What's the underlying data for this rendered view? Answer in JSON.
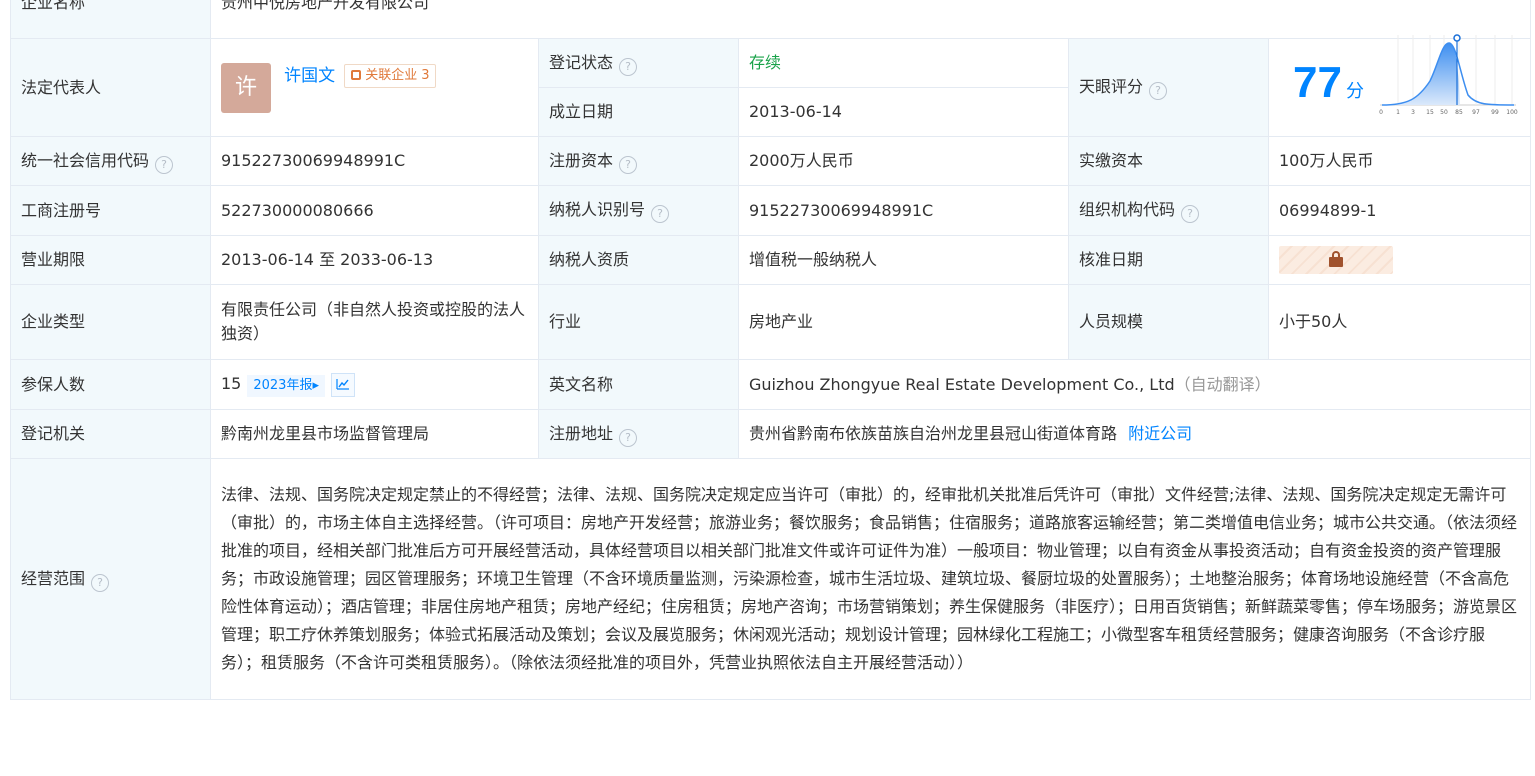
{
  "prev_row": {
    "label": "企业名称",
    "value": "贵州中悦房地产开发有限公司"
  },
  "legal_rep": {
    "label": "法定代表人",
    "avatar_char": "许",
    "name": "许国文",
    "related_label": "关联企业",
    "related_count": "3"
  },
  "reg_status": {
    "label": "登记状态",
    "value": "存续"
  },
  "est_date": {
    "label": "成立日期",
    "value": "2013-06-14"
  },
  "tianyan_score": {
    "label": "天眼评分",
    "score": "77",
    "unit": "分",
    "curve_ticks": [
      "0",
      "1",
      "3",
      "15",
      "50",
      "85",
      "97",
      "99",
      "100"
    ]
  },
  "credit_code": {
    "label": "统一社会信用代码",
    "value": "91522730069948991C"
  },
  "reg_capital": {
    "label": "注册资本",
    "value": "2000万人民币"
  },
  "paid_capital": {
    "label": "实缴资本",
    "value": "100万人民币"
  },
  "biz_reg_no": {
    "label": "工商注册号",
    "value": "522730000080666"
  },
  "taxpayer_id": {
    "label": "纳税人识别号",
    "value": "91522730069948991C"
  },
  "org_code": {
    "label": "组织机构代码",
    "value": "06994899-1"
  },
  "biz_term": {
    "label": "营业期限",
    "value": "2013-06-14 至 2033-06-13"
  },
  "taxpayer_qual": {
    "label": "纳税人资质",
    "value": "增值税一般纳税人"
  },
  "approval_date": {
    "label": "核准日期"
  },
  "company_type": {
    "label": "企业类型",
    "value": "有限责任公司（非自然人投资或控股的法人独资）"
  },
  "industry": {
    "label": "行业",
    "value": "房地产业"
  },
  "staff_size": {
    "label": "人员规模",
    "value": "小于50人"
  },
  "insured": {
    "label": "参保人数",
    "value": "15",
    "year_tag": "2023年报▸"
  },
  "english_name": {
    "label": "英文名称",
    "value": "Guizhou Zhongyue Real Estate Development Co., Ltd",
    "note": "（自动翻译）"
  },
  "reg_authority": {
    "label": "登记机关",
    "value": "黔南州龙里县市场监督管理局"
  },
  "reg_address": {
    "label": "注册地址",
    "value": "贵州省黔南布依族苗族自治州龙里县冠山街道体育路",
    "link": "附近公司"
  },
  "biz_scope": {
    "label": "经营范围",
    "value": "法律、法规、国务院决定规定禁止的不得经营；法律、法规、国务院决定规定应当许可（审批）的，经审批机关批准后凭许可（审批）文件经营;法律、法规、国务院决定规定无需许可（审批）的，市场主体自主选择经营。（许可项目：房地产开发经营；旅游业务；餐饮服务；食品销售；住宿服务；道路旅客运输经营；第二类增值电信业务；城市公共交通。（依法须经批准的项目，经相关部门批准后方可开展经营活动，具体经营项目以相关部门批准文件或许可证件为准）一般项目：物业管理；以自有资金从事投资活动；自有资金投资的资产管理服务；市政设施管理；园区管理服务；环境卫生管理（不含环境质量监测，污染源检查，城市生活垃圾、建筑垃圾、餐厨垃圾的处置服务）；土地整治服务；体育场地设施经营（不含高危险性体育运动）；酒店管理；非居住房地产租赁；房地产经纪；住房租赁；房地产咨询；市场营销策划；养生保健服务（非医疗）；日用百货销售；新鲜蔬菜零售；停车场服务；游览景区管理；职工疗休养策划服务；体验式拓展活动及策划；会议及展览服务；休闲观光活动；规划设计管理；园林绿化工程施工；小微型客车租赁经营服务；健康咨询服务（不含诊疗服务）；租赁服务（不含许可类租赁服务）。（除依法须经批准的项目外，凭营业执照依法自主开展经营活动））"
  },
  "icons": {
    "help": "question-circle-icon",
    "lock": "lock-icon",
    "trend": "trend-chart-icon",
    "related": "related-company-icon"
  },
  "colors": {
    "label_bg": "#f2f9fc",
    "accent": "#0084ff",
    "status_green": "#1aa34a",
    "border": "#e4eaf2"
  }
}
